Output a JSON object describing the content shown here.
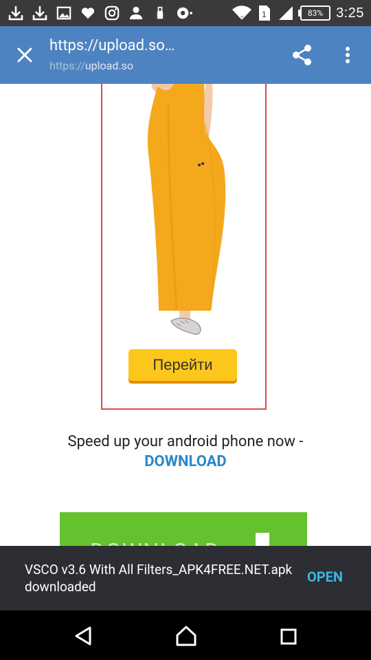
{
  "status_bar": {
    "time": "3:25",
    "battery": "83%",
    "sim": "1",
    "left_icons": [
      "download-icon",
      "download-icon",
      "image-icon",
      "heart-icon",
      "instagram-icon",
      "person-icon",
      "usb-icon",
      "camera-icon"
    ],
    "right_icons": [
      "wifi-icon",
      "sim-icon",
      "signal-icon",
      "battery-icon"
    ]
  },
  "toolbar": {
    "title": "https://upload.so…",
    "subtitle_scheme": "https://",
    "subtitle_host": "upload.so",
    "icons": [
      "close-icon",
      "share-icon",
      "more-vert-icon"
    ]
  },
  "ad": {
    "button_label": "Перейти"
  },
  "promo": {
    "text": "Speed up your android phone now -",
    "link": "DOWNLOAD"
  },
  "banner": {
    "text": "DOWNLOAD"
  },
  "snackbar": {
    "message": "VSCO v3.6 With All Filters_APK4FREE.NET.apk downloaded",
    "action": "OPEN"
  },
  "nav": {
    "icons": [
      "back-icon",
      "home-icon",
      "recents-icon"
    ]
  },
  "colors": {
    "toolbar": "#4e83c1",
    "ad_border": "#d74a4f",
    "ad_button": "#fdc61a",
    "link": "#2a87c7",
    "banner": "#66c12f",
    "snackbar": "#2c2e33",
    "snack_action": "#3bb5e6"
  }
}
